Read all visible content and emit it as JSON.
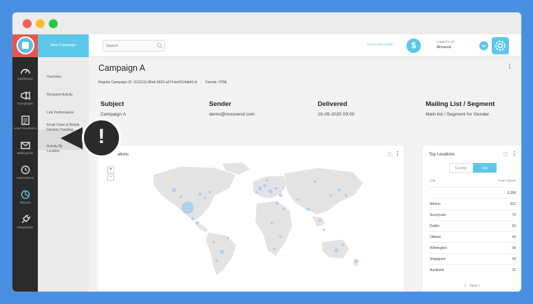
{
  "app": {
    "new_campaign_label": "New Campaign"
  },
  "nav": {
    "items": [
      {
        "label": "Dashboard",
        "icon": "speedometer-icon"
      },
      {
        "label": "Campaigns",
        "icon": "megaphone-icon"
      },
      {
        "label": "Lead Generation",
        "icon": "form-icon"
      },
      {
        "label": "Mailing lists",
        "icon": "envelope-icon"
      },
      {
        "label": "Automations",
        "icon": "clock-icon"
      },
      {
        "label": "Reports",
        "icon": "pie-chart-icon"
      },
      {
        "label": "Integrations",
        "icon": "plug-icon"
      }
    ],
    "active": "Reports"
  },
  "subnav": {
    "items": [
      "Overview",
      "Recipient Activity",
      "Link Performance",
      "Email Client & Mobile Devices Tracking",
      "Activity By Location"
    ]
  },
  "topbar": {
    "search_placeholder": "Search",
    "credits": "8,838,108 credits",
    "logged_in_label": "Logged in as",
    "user": "Moosend"
  },
  "campaign": {
    "title": "Campaign A",
    "id_label": "Regular Campaign ID: 11111111-86e6-4932-a274-be0314db41c4",
    "format_label": "Format: HTML",
    "columns": [
      {
        "header": "Subject",
        "value": "Campaign A"
      },
      {
        "header": "Sender",
        "value": "demo@moosend.com"
      },
      {
        "header": "Delivered",
        "value": "10-05-2020 09:00"
      },
      {
        "header": "Mailing List / Segment",
        "value": "Main list / Segment for Gender"
      }
    ]
  },
  "map_card": {
    "title_partial": "ations",
    "zoom_in": "+",
    "zoom_out": "-"
  },
  "top_locations": {
    "title": "Top Locations",
    "tabs": [
      "Country",
      "City"
    ],
    "active_tab": "City",
    "col_city": "City",
    "col_opens": "Total Opens",
    "rows": [
      {
        "city": "",
        "opens": "3,398"
      },
      {
        "city": "Athens",
        "opens": "321"
      },
      {
        "city": "Sunnyvale",
        "opens": "72"
      },
      {
        "city": "Dublin",
        "opens": "63"
      },
      {
        "city": "Ottawa",
        "opens": "43"
      },
      {
        "city": "Wilmington",
        "opens": "39"
      },
      {
        "city": "Singapore",
        "opens": "34"
      },
      {
        "city": "Auckland",
        "opens": "21"
      }
    ],
    "page": "1",
    "next": "Next >"
  },
  "callout": {
    "mark": "!"
  },
  "colors": {
    "accent": "#5bc8ea",
    "sidebar": "#2b2b2b",
    "logo_bg": "#e8574f",
    "background": "#4a90e2"
  }
}
